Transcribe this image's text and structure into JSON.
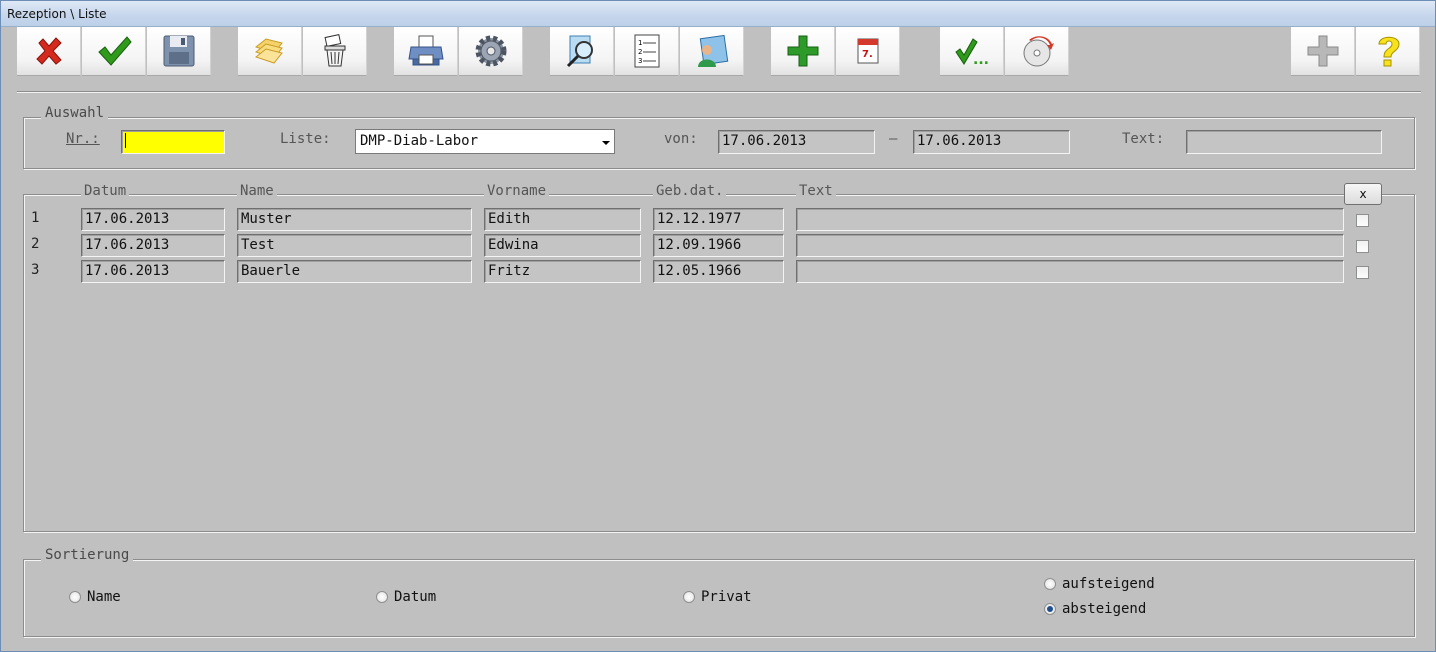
{
  "window": {
    "title": "Rezeption \\ Liste"
  },
  "toolbar": {
    "buttons": [
      {
        "icon": "close-x-icon"
      },
      {
        "icon": "checkmark-icon"
      },
      {
        "icon": "floppy-save-icon"
      },
      {
        "icon": "folders-icon"
      },
      {
        "icon": "trash-bin-icon"
      },
      {
        "icon": "printer-icon"
      },
      {
        "icon": "gear-icon"
      },
      {
        "icon": "search-document-icon"
      },
      {
        "icon": "numbered-list-icon"
      },
      {
        "icon": "person-card-icon"
      },
      {
        "icon": "plus-icon"
      },
      {
        "icon": "calendar-icon"
      },
      {
        "icon": "check-ellipsis-icon"
      },
      {
        "icon": "cd-rom-icon"
      },
      {
        "icon": "plus-gray-icon"
      },
      {
        "icon": "help-question-icon"
      }
    ],
    "check_more_label": "...",
    "calendar_day": "7."
  },
  "auswahl": {
    "legend": "Auswahl",
    "nr_label": "Nr.:",
    "nr_value": "",
    "liste_label": "Liste:",
    "liste_value": "DMP-Diab-Labor",
    "von_label": "von:",
    "von_value": "17.06.2013",
    "dash": "–",
    "bis_value": "17.06.2013",
    "text_label": "Text:",
    "text_value": ""
  },
  "table": {
    "headers": {
      "datum": "Datum",
      "name": "Name",
      "vorname": "Vorname",
      "gebdat": "Geb.dat.",
      "text": "Text"
    },
    "clear_button": "x",
    "rows": [
      {
        "num": "1",
        "datum": "17.06.2013",
        "name": "Muster",
        "vorname": "Edith",
        "gebdat": "12.12.1977",
        "text": ""
      },
      {
        "num": "2",
        "datum": "17.06.2013",
        "name": "Test",
        "vorname": "Edwina",
        "gebdat": "12.09.1966",
        "text": ""
      },
      {
        "num": "3",
        "datum": "17.06.2013",
        "name": "Bauerle",
        "vorname": "Fritz",
        "gebdat": "12.05.1966",
        "text": ""
      }
    ]
  },
  "sortierung": {
    "legend": "Sortierung",
    "options": {
      "name": "Name",
      "datum": "Datum",
      "privat": "Privat"
    },
    "order": {
      "asc": "aufsteigend",
      "desc": "absteigend"
    },
    "selected_order": "absteigend"
  }
}
